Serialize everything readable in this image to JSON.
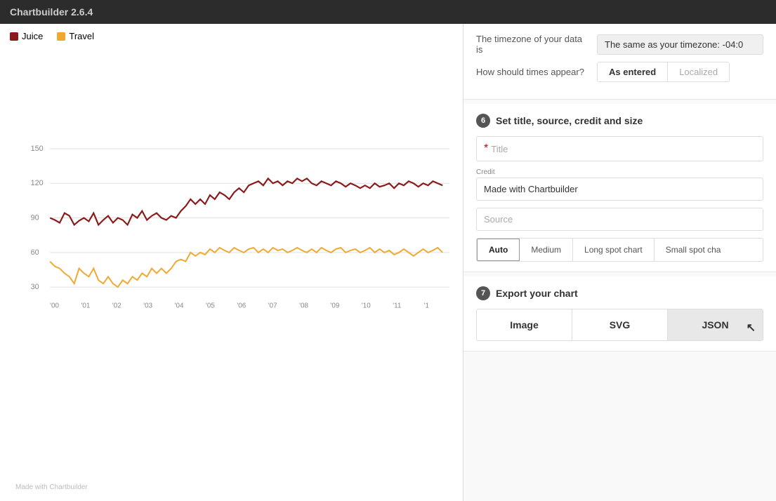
{
  "app": {
    "title": "Chartbuilder 2.6.4"
  },
  "chart": {
    "watermark": "Made with Chartbuilder",
    "legend": [
      {
        "label": "Juice",
        "color": "#8b1a1a"
      },
      {
        "label": "Travel",
        "color": "#f0a830"
      }
    ],
    "yAxis": {
      "ticks": [
        "150",
        "120",
        "90",
        "60",
        "30"
      ]
    },
    "xAxis": {
      "ticks": [
        "'00",
        "'01",
        "'02",
        "'03",
        "'04",
        "'05",
        "'06",
        "'07",
        "'08",
        "'09",
        "'10",
        "'11",
        "'1"
      ]
    }
  },
  "settings": {
    "timezone_label": "The timezone of your data is",
    "timezone_value": "The same as your timezone: -04:0",
    "times_label": "How should times appear?",
    "times_options": [
      {
        "label": "As entered",
        "active": true
      },
      {
        "label": "Localized",
        "active": false
      }
    ]
  },
  "step6": {
    "badge": "6",
    "title": "Set title, source, credit and size",
    "title_placeholder": "Title",
    "credit_label": "Credit",
    "credit_value": "Made with Chartbuilder",
    "source_placeholder": "Source",
    "size_buttons": [
      {
        "label": "Auto",
        "active": true
      },
      {
        "label": "Medium",
        "active": false
      },
      {
        "label": "Long spot chart",
        "active": false
      },
      {
        "label": "Small spot cha",
        "active": false
      }
    ]
  },
  "step7": {
    "badge": "7",
    "title": "Export your chart",
    "export_buttons": [
      {
        "label": "Image"
      },
      {
        "label": "SVG"
      },
      {
        "label": "JSON"
      }
    ]
  }
}
